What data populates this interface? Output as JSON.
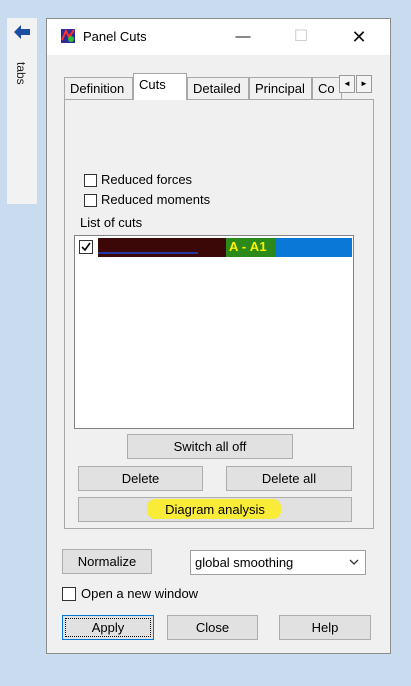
{
  "dock": {
    "label": "tabs",
    "arrow_icon": "arrow-left-icon"
  },
  "window": {
    "title": "Panel Cuts",
    "app_icon": "panel-cuts-app-icon",
    "minimize_glyph": "—",
    "maximize_glyph": "☐",
    "close_glyph": "✕"
  },
  "tabs": [
    {
      "label": "Definition",
      "active": false
    },
    {
      "label": "Cuts",
      "active": true
    },
    {
      "label": "Detailed",
      "active": false
    },
    {
      "label": "Principal",
      "active": false
    },
    {
      "label": "Co",
      "active": false
    }
  ],
  "tab_scroll": {
    "left": "◄",
    "right": "►"
  },
  "cuts_tab": {
    "reduced_forces": {
      "label": "Reduced forces",
      "checked": false
    },
    "reduced_moments": {
      "label": "Reduced moments",
      "checked": false
    },
    "list_label": "List of cuts",
    "list_items": [
      {
        "label": "A - A1",
        "checked": true,
        "selected": true
      }
    ],
    "switch_all_off": "Switch all off",
    "delete": "Delete",
    "delete_all": "Delete all",
    "diagram_analysis": "Diagram analysis"
  },
  "bottom": {
    "normalize": "Normalize",
    "smoothing": {
      "value": "global smoothing"
    },
    "open_new_window": {
      "label": "Open a new window",
      "checked": false
    },
    "apply": "Apply",
    "close": "Close",
    "help": "Help"
  },
  "colors": {
    "highlight": "#ffef00",
    "selection": "#0a78d7",
    "accent": "#0078d7"
  }
}
